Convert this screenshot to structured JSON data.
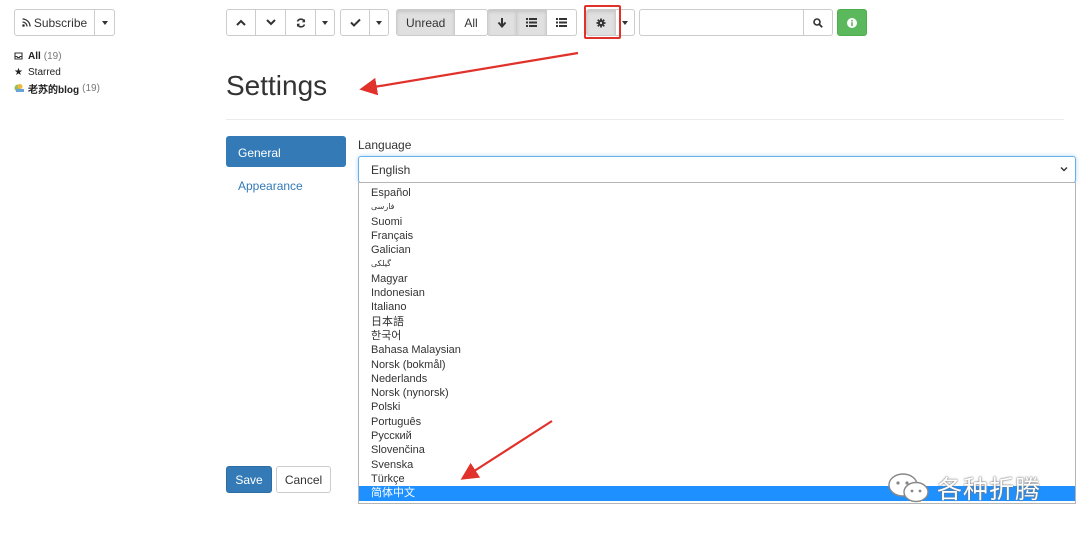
{
  "sidebar": {
    "subscribe_label": "Subscribe",
    "feeds": [
      {
        "label": "All",
        "count": "(19)"
      },
      {
        "label": "Starred",
        "count": ""
      },
      {
        "label": "老苏的blog",
        "count": "(19)"
      }
    ]
  },
  "toolbar": {
    "unread_label": "Unread",
    "all_label": "All",
    "search_placeholder": ""
  },
  "settings": {
    "title": "Settings",
    "tabs": [
      "General",
      "Appearance"
    ],
    "language_label": "Language",
    "selected_language": "English",
    "language_options": [
      "Español",
      "فارسی",
      "Suomi",
      "Français",
      "Galician",
      "گیلکی",
      "Magyar",
      "Indonesian",
      "Italiano",
      "日本語",
      "한국어",
      "Bahasa Malaysian",
      "Norsk (bokmål)",
      "Nederlands",
      "Norsk (nynorsk)",
      "Polski",
      "Português",
      "Русский",
      "Slovenčina",
      "Svenska",
      "Türkçe",
      "简体中文"
    ],
    "highlighted_option": "简体中文",
    "save_label": "Save",
    "cancel_label": "Cancel"
  },
  "watermark": {
    "text": "各种折腾"
  },
  "colors": {
    "primary": "#337ab7",
    "success": "#5cb85c",
    "highlight": "#1e90ff",
    "annotation": "#e0312b"
  },
  "icons": [
    "rss-icon",
    "chevron-up-icon",
    "chevron-down-icon",
    "refresh-icon",
    "check-icon",
    "arrow-down-icon",
    "list-icon",
    "gear-icon",
    "search-icon",
    "info-icon",
    "inbox-icon",
    "star-icon",
    "feed-favicon",
    "wechat-icon"
  ]
}
